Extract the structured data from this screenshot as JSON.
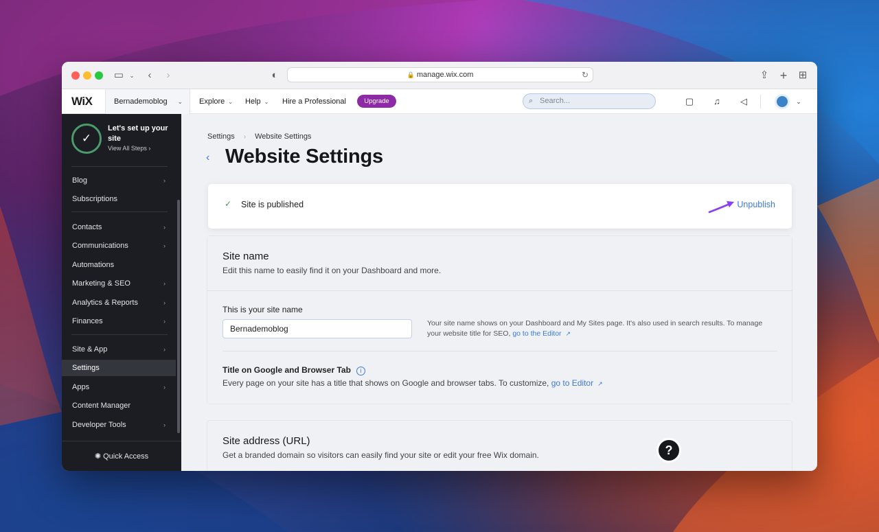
{
  "browser": {
    "url": "manage.wix.com"
  },
  "topbar": {
    "logo": "WiX",
    "site_name": "Bernademoblog",
    "nav": [
      "Explore",
      "Help",
      "Hire a Professional"
    ],
    "upgrade_label": "Upgrade",
    "search_placeholder": "Search..."
  },
  "sidebar": {
    "setup_title": "Let's set up your site",
    "setup_sub": "View All Steps",
    "items": [
      {
        "label": "Blog",
        "chevron": true
      },
      {
        "label": "Subscriptions",
        "chevron": false
      },
      {
        "label": "Contacts",
        "chevron": true
      },
      {
        "label": "Communications",
        "chevron": true
      },
      {
        "label": "Automations",
        "chevron": false
      },
      {
        "label": "Marketing & SEO",
        "chevron": true
      },
      {
        "label": "Analytics & Reports",
        "chevron": true
      },
      {
        "label": "Finances",
        "chevron": true
      },
      {
        "label": "Site & App",
        "chevron": true
      },
      {
        "label": "Settings",
        "chevron": false,
        "active": true
      },
      {
        "label": "Apps",
        "chevron": true
      },
      {
        "label": "Content Manager",
        "chevron": false
      },
      {
        "label": "Developer Tools",
        "chevron": true
      }
    ],
    "quick_access": "Quick Access"
  },
  "main": {
    "breadcrumb": [
      "Settings",
      "Website Settings"
    ],
    "title": "Website Settings",
    "publish_status": "Site is published",
    "unpublish_label": "Unpublish",
    "site_name_card": {
      "heading": "Site name",
      "subheading": "Edit this name to easily find it on your Dashboard and more.",
      "field_label": "This is your site name",
      "field_value": "Bernademoblog",
      "help_text": "Your site name shows on your Dashboard and My Sites page. It's also used in search results. To manage your website title for SEO,",
      "help_link": "go to the Editor",
      "title_heading": "Title on Google and Browser Tab",
      "title_text": "Every page on your site has a title that shows on Google and browser tabs. To customize,",
      "title_link": "go to Editor"
    },
    "url_card": {
      "heading": "Site address (URL)",
      "subheading": "Get a branded domain so visitors can easily find your site or edit your free Wix domain."
    },
    "help_button": "?"
  },
  "colors": {
    "accent": "#3b7ad9",
    "upgrade": "#8e2aa6",
    "sidebar_bg": "#1b1d22",
    "annotation_arrow": "#8a3ff0"
  }
}
